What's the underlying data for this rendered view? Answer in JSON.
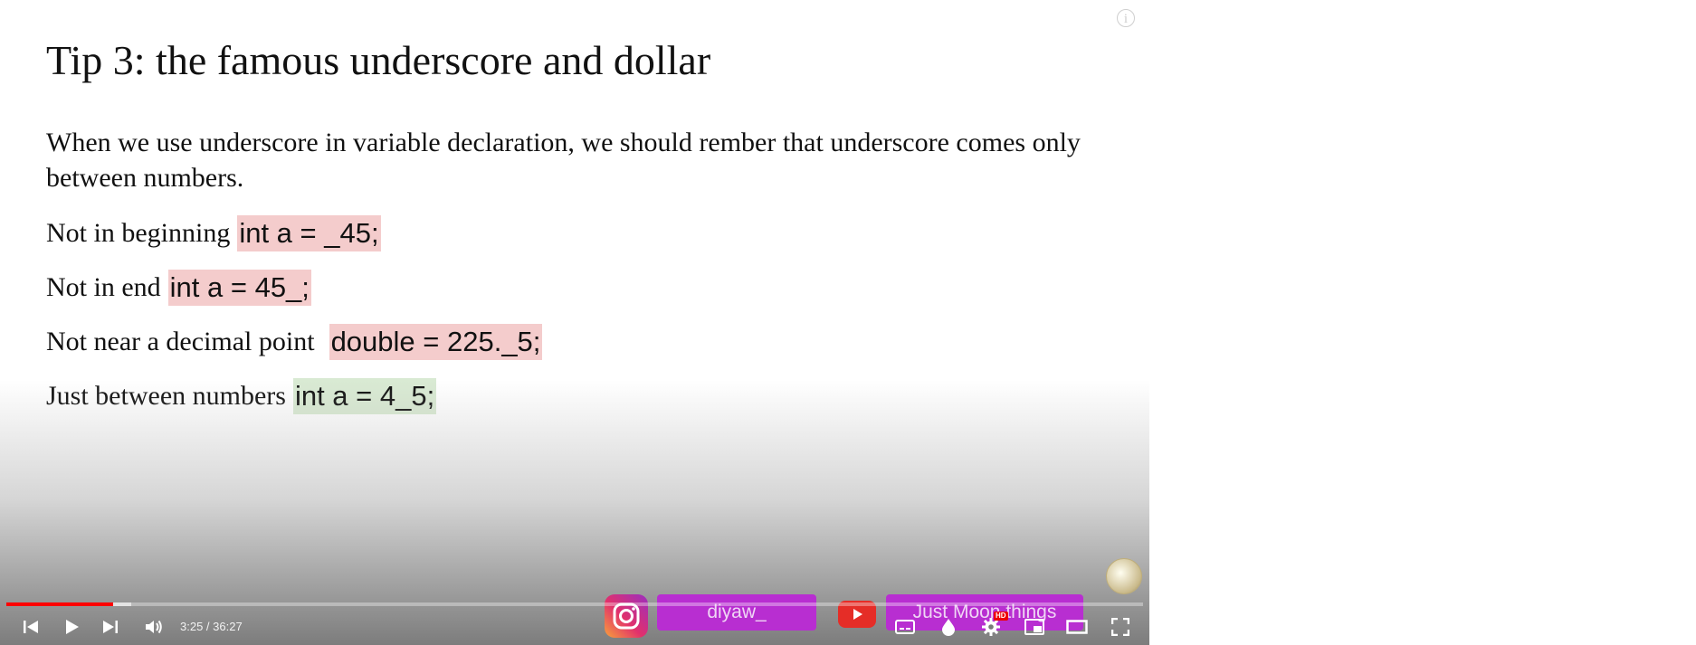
{
  "slide": {
    "title": "Tip 3: the famous underscore and dollar",
    "paragraph": "When we use underscore in variable declaration, we should rember that underscore comes only between numbers.",
    "rules": [
      {
        "text": "Not in beginning",
        "code": "int a = _45;",
        "status": "invalid"
      },
      {
        "text": "Not in end",
        "code": "int a = 45_;",
        "status": "invalid"
      },
      {
        "text": "Not near a decimal point",
        "code": "double = 225._5;",
        "status": "invalid"
      },
      {
        "text": "Just between numbers",
        "code": "int a = 4_5;",
        "status": "valid"
      }
    ]
  },
  "overlay": {
    "instagram_handle": "diyaw_",
    "youtube_channel": "Just Moon things"
  },
  "player": {
    "time_display": "3:25 / 36:27",
    "progress_fraction": 0.094,
    "buffered_fraction": 0.11,
    "hd_badge": "HD",
    "icons": {
      "previous": "skip-previous-icon",
      "play": "play-icon",
      "next": "skip-next-icon",
      "volume": "volume-icon",
      "subtitles": "subtitles-icon",
      "ambient": "ambient-mode-icon",
      "settings": "gear-icon",
      "miniplayer": "miniplayer-icon",
      "theater": "theater-mode-icon",
      "fullscreen": "fullscreen-icon",
      "info": "info-icon"
    }
  },
  "colors": {
    "progress": "#ff0000",
    "invalid_highlight": "#f4cccc",
    "valid_highlight": "#d9ead3",
    "pill": "#b82ed1"
  }
}
